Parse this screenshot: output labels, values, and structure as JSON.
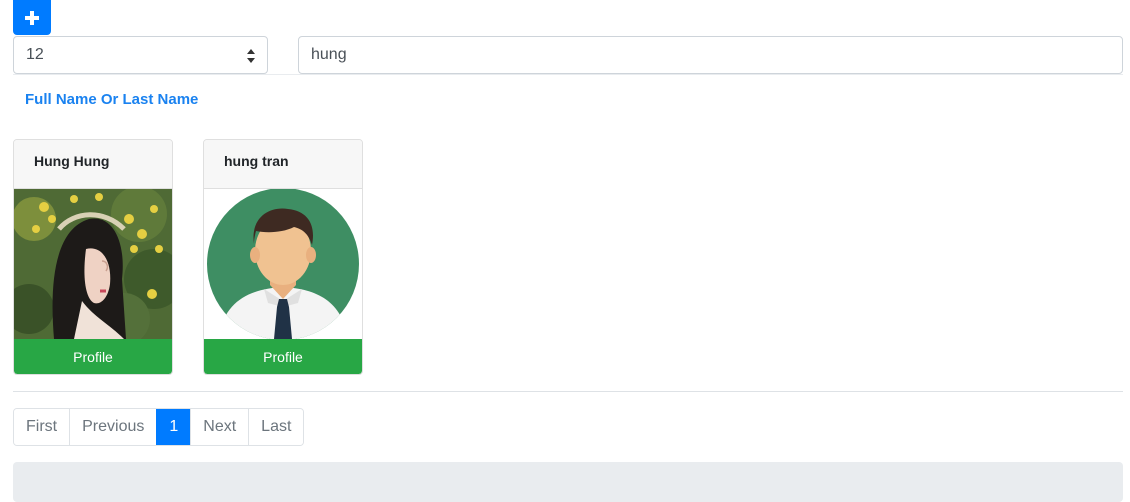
{
  "toolbar": {
    "add_icon": "plus-icon"
  },
  "page_size": {
    "value": "12",
    "icon": "sort-arrows-icon"
  },
  "search": {
    "value": "hung"
  },
  "filter_label": "Full Name Or Last Name",
  "users": [
    {
      "name": "Hung Hung",
      "button": "Profile"
    },
    {
      "name": "hung tran",
      "button": "Profile"
    }
  ],
  "pagination": {
    "first": "First",
    "previous": "Previous",
    "current": "1",
    "next": "Next",
    "last": "Last"
  },
  "colors": {
    "primary": "#007bff",
    "success": "#28a745",
    "label_blue": "#1a82f0"
  }
}
